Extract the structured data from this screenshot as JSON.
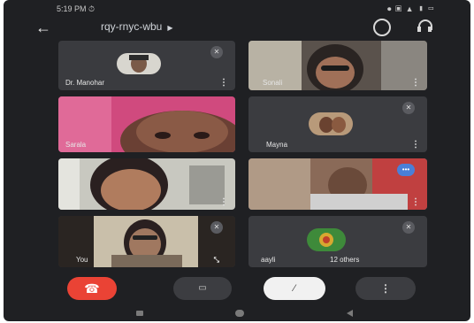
{
  "status_bar": {
    "time": "5:19 PM ⏱",
    "indicators": "⏺ ▣ ▲ ▮ ▭"
  },
  "header": {
    "meeting_code": "rqy-rnyc-wbu",
    "back_icon": "arrow-left-icon",
    "rotate_icon": "camera-switch-icon",
    "audio_icon": "headphones-icon"
  },
  "participants": [
    {
      "name": "Dr. Manohar",
      "muted": true
    },
    {
      "name": "Sonali",
      "muted": false
    },
    {
      "name": "Sarala",
      "muted": false
    },
    {
      "name": "Mayna",
      "muted": true
    },
    {
      "name": "",
      "muted": false
    },
    {
      "name": "",
      "muted": false,
      "speaking": true
    },
    {
      "name": "You",
      "muted": true
    },
    {
      "name": "aayli",
      "muted": true,
      "others": "12 others"
    }
  ],
  "controls": {
    "end_call": "end-call-icon",
    "camera": "camera-icon",
    "mic": "mic-off-icon",
    "more": "more-options-icon"
  },
  "colors": {
    "background": "#1f2023",
    "tile": "#3b3c40",
    "end_call": "#ea4335",
    "speaking_border": "#4a7fd8"
  }
}
